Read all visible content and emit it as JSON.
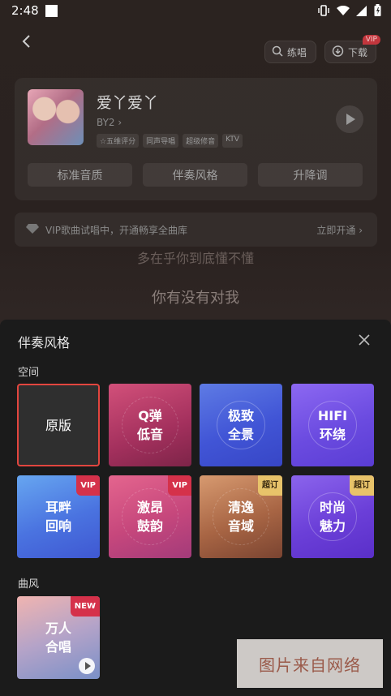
{
  "status_bar": {
    "time": "2:48"
  },
  "top_bar": {
    "practice_label": "练唱",
    "download_label": "下载",
    "download_badge": "VIP"
  },
  "song": {
    "title": "爱丫爱丫",
    "artist": "BY2",
    "tags": [
      "☆五维评分",
      "同声导唱",
      "超级修音",
      "KTV"
    ]
  },
  "card_buttons": [
    "标准音质",
    "伴奏风格",
    "升降调"
  ],
  "vip_banner": {
    "message": "VIP歌曲试唱中，开通畅享全曲库",
    "action": "立即开通"
  },
  "lyrics": {
    "line1": "多在乎你到底懂不懂",
    "line2": "你有没有对我"
  },
  "sheet": {
    "title": "伴奏风格",
    "section_space": "空间",
    "section_style": "曲风",
    "space_tiles": [
      {
        "label": "原版",
        "badge": ""
      },
      {
        "label": "Q弹\n低音",
        "badge": ""
      },
      {
        "label": "极致\n全景",
        "badge": ""
      },
      {
        "label": "HIFI\n环绕",
        "badge": ""
      },
      {
        "label": "耳畔\n回响",
        "badge": "VIP"
      },
      {
        "label": "激昂\n鼓韵",
        "badge": "VIP"
      },
      {
        "label": "清逸\n音域",
        "badge": "超订"
      },
      {
        "label": "时尚\n魅力",
        "badge": "超订"
      }
    ],
    "style_tiles": [
      {
        "label": "万人\n合唱",
        "badge": "NEW"
      }
    ]
  },
  "watermark": "图片来自网络",
  "colors": {
    "selected_border": "#e2463f",
    "vip_badge": "#d5314a",
    "super_badge": "#e8c36a"
  }
}
